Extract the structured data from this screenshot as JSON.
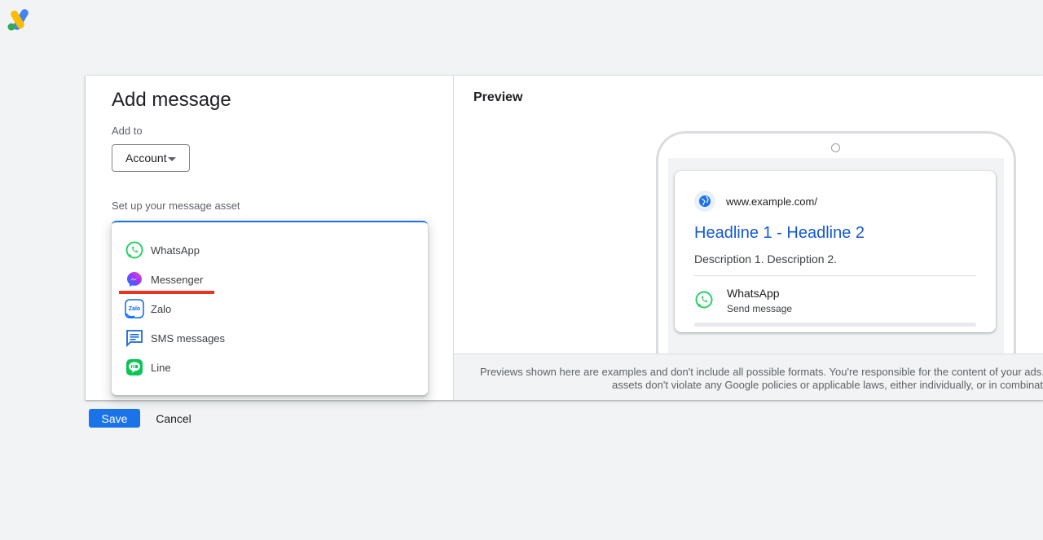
{
  "app": {
    "logo_icon": "google-ads-logo"
  },
  "dialog": {
    "title": "Add message",
    "add_to_label": "Add to",
    "add_to_value": "Account",
    "setup_label": "Set up your message asset",
    "options": [
      {
        "label": "WhatsApp",
        "icon": "whatsapp-icon"
      },
      {
        "label": "Messenger",
        "icon": "messenger-icon"
      },
      {
        "label": "Zalo",
        "icon": "zalo-icon"
      },
      {
        "label": "SMS messages",
        "icon": "sms-icon"
      },
      {
        "label": "Line",
        "icon": "line-icon"
      }
    ],
    "highlight_color": "#ea3323"
  },
  "preview": {
    "title": "Preview",
    "url": "www.example.com/",
    "headline": "Headline 1 - Headline 2",
    "description": "Description 1. Description 2.",
    "extension_title": "WhatsApp",
    "extension_sub": "Send message",
    "disclaimer_line1": "Previews shown here are examples and don't include all possible formats. You're responsible for the content of your ads. Pl",
    "disclaimer_line2": "assets don't violate any Google policies or applicable laws, either individually, or in combinat"
  },
  "actions": {
    "save_label": "Save",
    "cancel_label": "Cancel"
  },
  "colors": {
    "accent": "#1a73e8",
    "whatsapp": "#25d366",
    "line": "#06c755",
    "link": "#1558d6"
  }
}
